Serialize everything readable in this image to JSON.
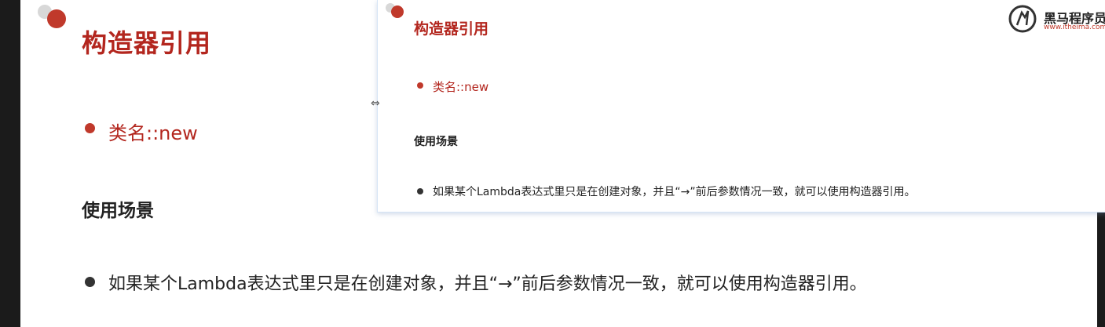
{
  "main": {
    "title": "构造器引用",
    "bullet1": "类名::new",
    "section_heading": "使用场景",
    "bullet2": "如果某个Lambda表达式里只是在创建对象，并且“→”前后参数情况一致，就可以使用构造器引用。"
  },
  "overlay": {
    "title": "构造器引用",
    "bullet1": "类名::new",
    "section_heading": "使用场景",
    "bullet2": "如果某个Lambda表达式里只是在创建对象，并且“→”前后参数情况一致，就可以使用构造器引用。",
    "logo_text": "黑马程序员",
    "logo_url": "www.itheima.com"
  },
  "colors": {
    "accent": "#b3261e",
    "frame": "#1b1b1b"
  },
  "icons": {
    "logo": "horse-logo-icon",
    "cursor": "resize-horizontal-icon"
  }
}
